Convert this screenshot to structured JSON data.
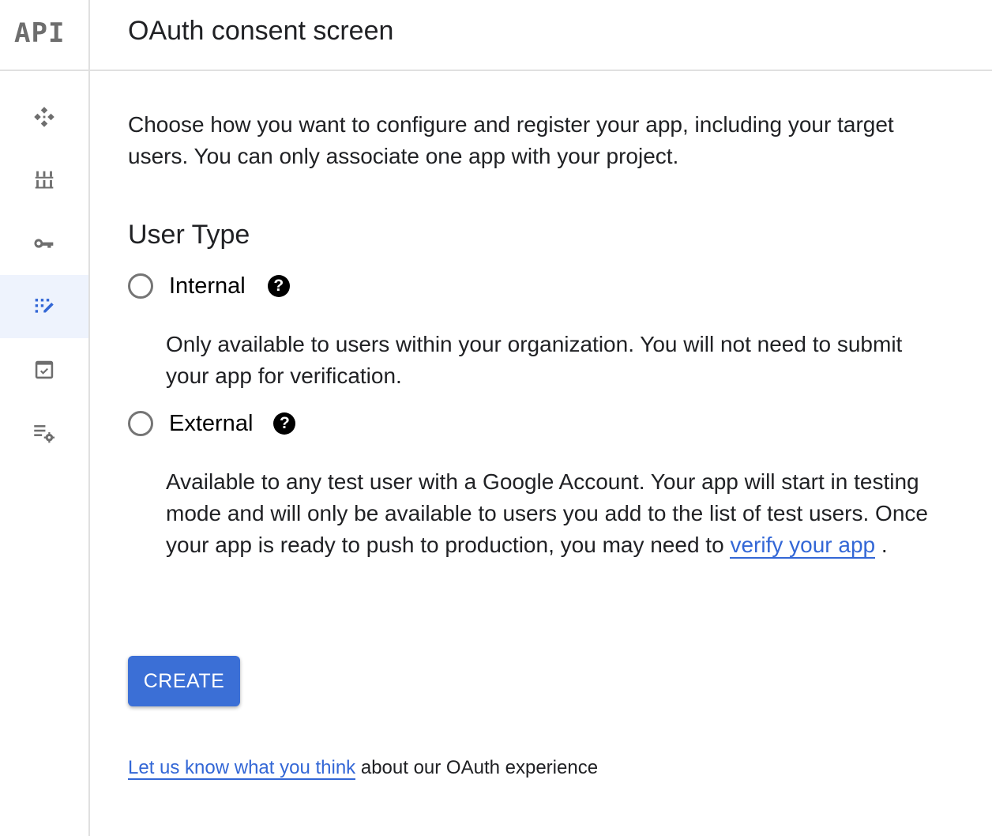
{
  "header": {
    "logo": "API",
    "title": "OAuth consent screen"
  },
  "sidebar": {
    "items": [
      {
        "icon": "dashboard-icon",
        "active": false
      },
      {
        "icon": "library-icon",
        "active": false
      },
      {
        "icon": "credentials-key-icon",
        "active": false
      },
      {
        "icon": "oauth-consent-icon",
        "active": true
      },
      {
        "icon": "domain-verification-icon",
        "active": false
      },
      {
        "icon": "page-usage-settings-icon",
        "active": false
      }
    ]
  },
  "main": {
    "intro": "Choose how you want to configure and register your app, including your target users. You can only associate one app with your project.",
    "user_type_title": "User Type",
    "options": [
      {
        "label": "Internal",
        "selected": false,
        "description": "Only available to users within your organization. You will not need to submit your app for verification."
      },
      {
        "label": "External",
        "selected": false,
        "description": "Available to any test user with a Google Account. Your app will start in testing mode and will only be available to users you add to the list of test users. Once your app is ready to push to production, you may need to",
        "link_text": "verify your app",
        "suffix": "."
      }
    ],
    "help_glyph": "?",
    "create_label": "CREATE",
    "feedback_link": "Let us know what you think",
    "feedback_text": " about our OAuth experience"
  },
  "colors": {
    "accent": "#3367d6",
    "button": "#3b6fd6",
    "active_nav_bg": "#eef3fd",
    "icon_gray": "#6e6e6e"
  }
}
